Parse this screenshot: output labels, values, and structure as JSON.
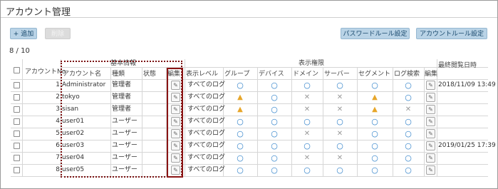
{
  "page": {
    "title": "アカウント管理",
    "count_text": "8 / 10"
  },
  "toolbar": {
    "add_label": "+ 追加",
    "delete_label": "削除",
    "password_rule_label": "パスワードルール設定",
    "account_rule_label": "アカウントルール設定"
  },
  "header": {
    "group_basic": "基本情報",
    "group_display": "表示権限",
    "account_no": "アカウントNo",
    "account_name": "アカウント名",
    "type": "種類",
    "status": "状態",
    "edit": "編集",
    "display_level": "表示レベル",
    "group": "グループ",
    "device": "デバイス",
    "domain": "ドメイン",
    "server": "サーバー",
    "segment": "セグメント",
    "log_search": "ログ検索",
    "edit2": "編集",
    "last_login": "最終閲覧日時"
  },
  "rows": [
    {
      "no": "1",
      "name": "Administrator",
      "type": "管理者",
      "level": "すべてのログ",
      "perms": [
        "ok",
        "ok",
        "ok",
        "ok",
        "ok",
        "ok"
      ],
      "last": "2018/11/09 13:49"
    },
    {
      "no": "2",
      "name": "tokyo",
      "type": "管理者",
      "level": "すべてのログ",
      "perms": [
        "warn",
        "ok",
        "ng",
        "ng",
        "warn",
        "ok"
      ],
      "last": ""
    },
    {
      "no": "3",
      "name": "sisan",
      "type": "管理者",
      "level": "すべてのログ",
      "perms": [
        "warn",
        "ok",
        "ng",
        "ng",
        "warn",
        "ng"
      ],
      "last": ""
    },
    {
      "no": "4",
      "name": "user01",
      "type": "ユーザー",
      "level": "すべてのログ",
      "perms": [
        "ok",
        "ok",
        "ok",
        "ok",
        "ok",
        "ok"
      ],
      "last": ""
    },
    {
      "no": "5",
      "name": "user02",
      "type": "ユーザー",
      "level": "すべてのログ",
      "perms": [
        "ok",
        "ok",
        "ng",
        "ng",
        "ok",
        "ok"
      ],
      "last": ""
    },
    {
      "no": "6",
      "name": "user03",
      "type": "ユーザー",
      "level": "すべてのログ",
      "perms": [
        "ok",
        "ok",
        "ok",
        "ok",
        "ok",
        "ok"
      ],
      "last": "2019/01/25 17:39"
    },
    {
      "no": "7",
      "name": "user04",
      "type": "ユーザー",
      "level": "すべてのログ",
      "perms": [
        "ok",
        "ok",
        "ng",
        "ng",
        "ok",
        "ok"
      ],
      "last": ""
    },
    {
      "no": "8",
      "name": "user05",
      "type": "ユーザー",
      "level": "すべてのログ",
      "perms": [
        "ok",
        "ok",
        "ok",
        "ok",
        "ok",
        "ok"
      ],
      "last": ""
    }
  ],
  "icons": {
    "ok": "circle-icon",
    "ng": "cross-icon",
    "warn": "warning-icon",
    "edit": "pencil-icon"
  },
  "colors": {
    "ok": "#2f80c9",
    "ng": "#9a9a9a",
    "warn": "#e7a62a",
    "highlight": "#8a1414"
  }
}
